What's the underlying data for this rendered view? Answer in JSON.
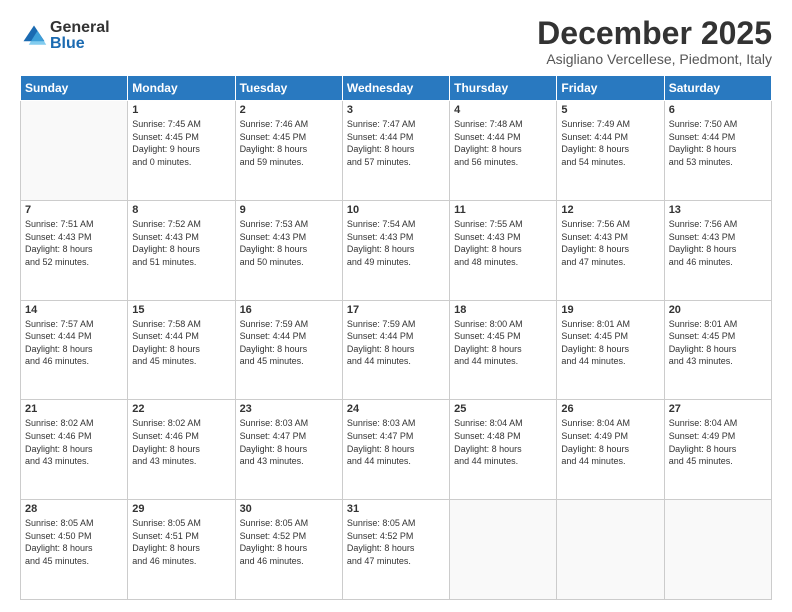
{
  "logo": {
    "general": "General",
    "blue": "Blue"
  },
  "title": "December 2025",
  "subtitle": "Asigliano Vercellese, Piedmont, Italy",
  "weekdays": [
    "Sunday",
    "Monday",
    "Tuesday",
    "Wednesday",
    "Thursday",
    "Friday",
    "Saturday"
  ],
  "weeks": [
    [
      {
        "day": "",
        "info": ""
      },
      {
        "day": "1",
        "info": "Sunrise: 7:45 AM\nSunset: 4:45 PM\nDaylight: 9 hours\nand 0 minutes."
      },
      {
        "day": "2",
        "info": "Sunrise: 7:46 AM\nSunset: 4:45 PM\nDaylight: 8 hours\nand 59 minutes."
      },
      {
        "day": "3",
        "info": "Sunrise: 7:47 AM\nSunset: 4:44 PM\nDaylight: 8 hours\nand 57 minutes."
      },
      {
        "day": "4",
        "info": "Sunrise: 7:48 AM\nSunset: 4:44 PM\nDaylight: 8 hours\nand 56 minutes."
      },
      {
        "day": "5",
        "info": "Sunrise: 7:49 AM\nSunset: 4:44 PM\nDaylight: 8 hours\nand 54 minutes."
      },
      {
        "day": "6",
        "info": "Sunrise: 7:50 AM\nSunset: 4:44 PM\nDaylight: 8 hours\nand 53 minutes."
      }
    ],
    [
      {
        "day": "7",
        "info": "Sunrise: 7:51 AM\nSunset: 4:43 PM\nDaylight: 8 hours\nand 52 minutes."
      },
      {
        "day": "8",
        "info": "Sunrise: 7:52 AM\nSunset: 4:43 PM\nDaylight: 8 hours\nand 51 minutes."
      },
      {
        "day": "9",
        "info": "Sunrise: 7:53 AM\nSunset: 4:43 PM\nDaylight: 8 hours\nand 50 minutes."
      },
      {
        "day": "10",
        "info": "Sunrise: 7:54 AM\nSunset: 4:43 PM\nDaylight: 8 hours\nand 49 minutes."
      },
      {
        "day": "11",
        "info": "Sunrise: 7:55 AM\nSunset: 4:43 PM\nDaylight: 8 hours\nand 48 minutes."
      },
      {
        "day": "12",
        "info": "Sunrise: 7:56 AM\nSunset: 4:43 PM\nDaylight: 8 hours\nand 47 minutes."
      },
      {
        "day": "13",
        "info": "Sunrise: 7:56 AM\nSunset: 4:43 PM\nDaylight: 8 hours\nand 46 minutes."
      }
    ],
    [
      {
        "day": "14",
        "info": "Sunrise: 7:57 AM\nSunset: 4:44 PM\nDaylight: 8 hours\nand 46 minutes."
      },
      {
        "day": "15",
        "info": "Sunrise: 7:58 AM\nSunset: 4:44 PM\nDaylight: 8 hours\nand 45 minutes."
      },
      {
        "day": "16",
        "info": "Sunrise: 7:59 AM\nSunset: 4:44 PM\nDaylight: 8 hours\nand 45 minutes."
      },
      {
        "day": "17",
        "info": "Sunrise: 7:59 AM\nSunset: 4:44 PM\nDaylight: 8 hours\nand 44 minutes."
      },
      {
        "day": "18",
        "info": "Sunrise: 8:00 AM\nSunset: 4:45 PM\nDaylight: 8 hours\nand 44 minutes."
      },
      {
        "day": "19",
        "info": "Sunrise: 8:01 AM\nSunset: 4:45 PM\nDaylight: 8 hours\nand 44 minutes."
      },
      {
        "day": "20",
        "info": "Sunrise: 8:01 AM\nSunset: 4:45 PM\nDaylight: 8 hours\nand 43 minutes."
      }
    ],
    [
      {
        "day": "21",
        "info": "Sunrise: 8:02 AM\nSunset: 4:46 PM\nDaylight: 8 hours\nand 43 minutes."
      },
      {
        "day": "22",
        "info": "Sunrise: 8:02 AM\nSunset: 4:46 PM\nDaylight: 8 hours\nand 43 minutes."
      },
      {
        "day": "23",
        "info": "Sunrise: 8:03 AM\nSunset: 4:47 PM\nDaylight: 8 hours\nand 43 minutes."
      },
      {
        "day": "24",
        "info": "Sunrise: 8:03 AM\nSunset: 4:47 PM\nDaylight: 8 hours\nand 44 minutes."
      },
      {
        "day": "25",
        "info": "Sunrise: 8:04 AM\nSunset: 4:48 PM\nDaylight: 8 hours\nand 44 minutes."
      },
      {
        "day": "26",
        "info": "Sunrise: 8:04 AM\nSunset: 4:49 PM\nDaylight: 8 hours\nand 44 minutes."
      },
      {
        "day": "27",
        "info": "Sunrise: 8:04 AM\nSunset: 4:49 PM\nDaylight: 8 hours\nand 45 minutes."
      }
    ],
    [
      {
        "day": "28",
        "info": "Sunrise: 8:05 AM\nSunset: 4:50 PM\nDaylight: 8 hours\nand 45 minutes."
      },
      {
        "day": "29",
        "info": "Sunrise: 8:05 AM\nSunset: 4:51 PM\nDaylight: 8 hours\nand 46 minutes."
      },
      {
        "day": "30",
        "info": "Sunrise: 8:05 AM\nSunset: 4:52 PM\nDaylight: 8 hours\nand 46 minutes."
      },
      {
        "day": "31",
        "info": "Sunrise: 8:05 AM\nSunset: 4:52 PM\nDaylight: 8 hours\nand 47 minutes."
      },
      {
        "day": "",
        "info": ""
      },
      {
        "day": "",
        "info": ""
      },
      {
        "day": "",
        "info": ""
      }
    ]
  ]
}
